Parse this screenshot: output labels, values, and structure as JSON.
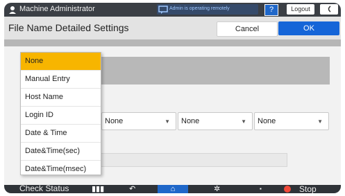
{
  "topbar": {
    "user_label": "Machine Administrator",
    "message": "Admin is operating remotely",
    "help_label": "?",
    "logout_label": "Logout",
    "user_icon": "user-icon",
    "message_icon": "message-icon",
    "back_icon": "back-icon"
  },
  "title": {
    "text": "File Name Detailed Settings",
    "cancel_label": "Cancel",
    "ok_label": "OK"
  },
  "dropdown_menu": {
    "items": [
      {
        "label": "None",
        "selected": true
      },
      {
        "label": "Manual Entry",
        "selected": false
      },
      {
        "label": "Host Name",
        "selected": false
      },
      {
        "label": "Login ID",
        "selected": false
      },
      {
        "label": "Date & Time",
        "selected": false
      },
      {
        "label": "Date&Time(sec)",
        "selected": false
      },
      {
        "label": "Date&Time(msec)",
        "selected": false
      }
    ]
  },
  "fields": [
    {
      "value": "None"
    },
    {
      "value": "None"
    },
    {
      "value": "None"
    }
  ],
  "bottombar": {
    "check_status_label": "Check Status",
    "stop_label": "Stop"
  },
  "colors": {
    "accent_blue": "#1565d8",
    "selected_yellow": "#f7b500",
    "topbar": "#3b3f45",
    "stop_red": "#f04a3a"
  }
}
